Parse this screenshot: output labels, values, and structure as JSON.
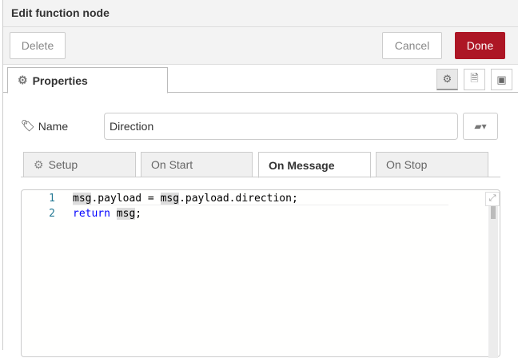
{
  "header": {
    "title": "Edit function node"
  },
  "buttons": {
    "delete": "Delete",
    "cancel": "Cancel",
    "done": "Done"
  },
  "colors": {
    "done_bg": "#ad1625",
    "header_bg": "#f3f3f3"
  },
  "tabs": {
    "properties": "Properties",
    "icons": [
      "gear-icon",
      "description-icon",
      "appearance-icon"
    ]
  },
  "name_field": {
    "label": "Name",
    "value": "Direction"
  },
  "function_tabs": [
    {
      "label": "Setup"
    },
    {
      "label": "On Start"
    },
    {
      "label": "On Message",
      "active": true
    },
    {
      "label": "On Stop"
    }
  ],
  "code": {
    "lines": [
      {
        "num": "1",
        "parts": [
          "msg",
          ".payload = ",
          "msg",
          ".payload.direction;"
        ]
      },
      {
        "num": "2",
        "parts": [
          "return",
          " ",
          "msg",
          ";"
        ]
      }
    ]
  }
}
